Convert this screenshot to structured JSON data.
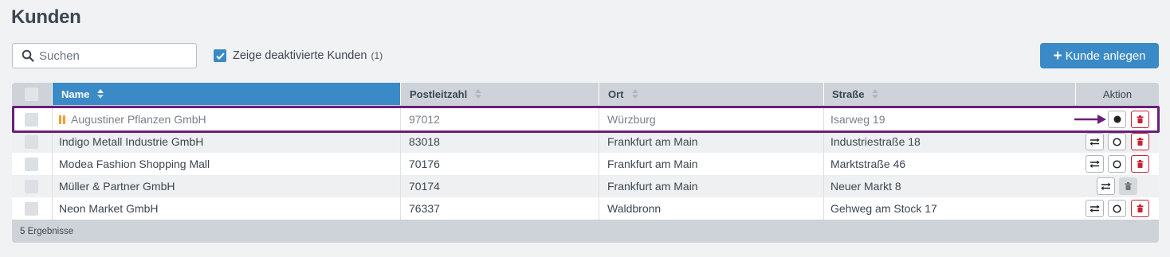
{
  "page": {
    "title": "Kunden"
  },
  "search": {
    "placeholder": "Suchen",
    "value": ""
  },
  "show_inactive": {
    "label": "Zeige deaktivierte Kunden",
    "count": "(1)",
    "checked": true
  },
  "add_button": {
    "label": "Kunde anlegen"
  },
  "table": {
    "columns": {
      "name": "Name",
      "plz": "Postleitzahl",
      "ort": "Ort",
      "strasse": "Straße",
      "aktion": "Aktion"
    },
    "sort": {
      "column": "Name",
      "direction": "ascending"
    },
    "rows": [
      {
        "name": "Augustiner Pflanzen GmbH",
        "plz": "97012",
        "ort": "Würzburg",
        "strasse": "Isarweg 19",
        "status": "deaktiviert",
        "highlighted": true
      },
      {
        "name": "Indigo Metall Industrie GmbH",
        "plz": "83018",
        "ort": "Frankfurt am Main",
        "strasse": "Industriestraße 18"
      },
      {
        "name": "Modea Fashion Shopping Mall",
        "plz": "70176",
        "ort": "Frankfurt am Main",
        "strasse": "Marktstraße 46"
      },
      {
        "name": "Müller & Partner GmbH",
        "plz": "70174",
        "ort": "Frankfurt am Main",
        "strasse": "Neuer Markt 8"
      },
      {
        "name": "Neon Market GmbH",
        "plz": "76337",
        "ort": "Waldbronn",
        "strasse": "Gehweg am Stock 17"
      }
    ],
    "footer": "5 Ergebnisse"
  },
  "colors": {
    "primary": "#3a8ac7",
    "highlight": "#6a1f7a",
    "danger": "#c82333",
    "paused": "#f0a132"
  }
}
